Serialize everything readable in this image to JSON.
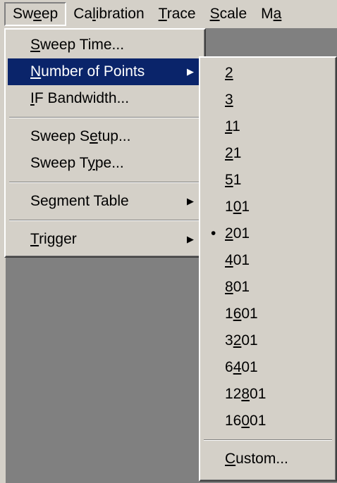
{
  "menubar": {
    "items": [
      {
        "pre": "Sw",
        "key": "e",
        "post": "ep"
      },
      {
        "pre": "Ca",
        "key": "l",
        "post": "ibration"
      },
      {
        "pre": "",
        "key": "T",
        "post": "race"
      },
      {
        "pre": "",
        "key": "S",
        "post": "cale"
      },
      {
        "pre": "M",
        "key": "a",
        "post": ""
      }
    ]
  },
  "sweep_menu": {
    "sweep_time": {
      "pre": "",
      "key": "S",
      "post": "weep Time..."
    },
    "number_of_points": {
      "pre": "",
      "key": "N",
      "post": "umber of Points"
    },
    "if_bandwidth": {
      "pre": "",
      "key": "I",
      "post": "F Bandwidth..."
    },
    "sweep_setup": {
      "pre": "Sweep S",
      "key": "e",
      "post": "tup..."
    },
    "sweep_type": {
      "pre": "Sweep T",
      "key": "y",
      "post": "pe..."
    },
    "segment_table": {
      "pre": "Segment Table",
      "key": "",
      "post": ""
    },
    "trigger": {
      "pre": "",
      "key": "T",
      "post": "rigger"
    },
    "arrow": "▶"
  },
  "points_menu": {
    "selected_bullet": "•",
    "items": [
      {
        "pre": "",
        "key": "2",
        "post": ""
      },
      {
        "pre": "",
        "key": "3",
        "post": ""
      },
      {
        "pre": "",
        "key": "1",
        "post": "1"
      },
      {
        "pre": "",
        "key": "2",
        "post": "1"
      },
      {
        "pre": "",
        "key": "5",
        "post": "1"
      },
      {
        "pre": "1",
        "key": "0",
        "post": "1"
      },
      {
        "pre": "",
        "key": "2",
        "post": "01"
      },
      {
        "pre": "",
        "key": "4",
        "post": "01"
      },
      {
        "pre": "",
        "key": "8",
        "post": "01"
      },
      {
        "pre": "1",
        "key": "6",
        "post": "01"
      },
      {
        "pre": "3",
        "key": "2",
        "post": "01"
      },
      {
        "pre": "6",
        "key": "4",
        "post": "01"
      },
      {
        "pre": "12",
        "key": "8",
        "post": "01"
      },
      {
        "pre": "16",
        "key": "0",
        "post": "01"
      }
    ],
    "custom": {
      "pre": "",
      "key": "C",
      "post": "ustom..."
    }
  }
}
